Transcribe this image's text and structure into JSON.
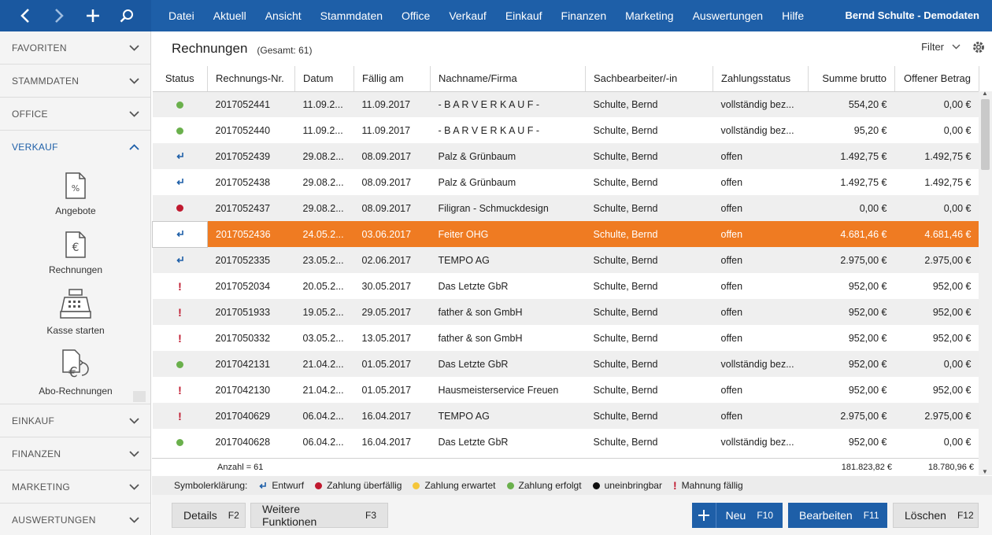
{
  "topbar": {
    "menu": [
      "Datei",
      "Aktuell",
      "Ansicht",
      "Stammdaten",
      "Office",
      "Verkauf",
      "Einkauf",
      "Finanzen",
      "Marketing",
      "Auswertungen",
      "Hilfe"
    ],
    "user": "Bernd Schulte - Demodaten",
    "icons": [
      "chevron-left-icon",
      "chevron-right-icon",
      "plus-icon",
      "search-icon"
    ]
  },
  "sidebar": {
    "sections_top": [
      "FAVORITEN",
      "STAMMDATEN",
      "OFFICE"
    ],
    "active_section": "VERKAUF",
    "tiles": [
      {
        "label": "Angebote",
        "icon": "offer-document-icon"
      },
      {
        "label": "Rechnungen",
        "icon": "invoice-euro-document-icon"
      },
      {
        "label": "Kasse starten",
        "icon": "cash-register-icon"
      },
      {
        "label": "Abo-Rechnungen",
        "icon": "subscription-invoice-icon"
      }
    ],
    "sections_bottom": [
      "EINKAUF",
      "FINANZEN",
      "MARKETING",
      "AUSWERTUNGEN"
    ]
  },
  "main": {
    "title": "Rechnungen",
    "total": "(Gesamt: 61)",
    "filter_label": "Filter"
  },
  "table": {
    "columns": [
      "Status",
      "Rechnungs-Nr.",
      "Datum",
      "Fällig am",
      "Nachname/Firma",
      "Sachbearbeiter/-in",
      "Zahlungsstatus",
      "Summe brutto",
      "Offener Betrag"
    ],
    "rows": [
      {
        "status": "green",
        "nr": "2017052441",
        "datum": "11.09.2...",
        "faellig": "11.09.2017",
        "firma": "- B A R V E R K A U F -",
        "bearbeiter": "Schulte, Bernd",
        "zahlung": "vollständig bez...",
        "brutto": "554,20 €",
        "offen": "0,00 €"
      },
      {
        "status": "green",
        "nr": "2017052440",
        "datum": "11.09.2...",
        "faellig": "11.09.2017",
        "firma": "- B A R V E R K A U F -",
        "bearbeiter": "Schulte, Bernd",
        "zahlung": "vollständig bez...",
        "brutto": "95,20 €",
        "offen": "0,00 €"
      },
      {
        "status": "entwurf",
        "nr": "2017052439",
        "datum": "29.08.2...",
        "faellig": "08.09.2017",
        "firma": "Palz & Grünbaum",
        "bearbeiter": "Schulte, Bernd",
        "zahlung": "offen",
        "brutto": "1.492,75 €",
        "offen": "1.492,75 €"
      },
      {
        "status": "entwurf",
        "nr": "2017052438",
        "datum": "29.08.2...",
        "faellig": "08.09.2017",
        "firma": "Palz & Grünbaum",
        "bearbeiter": "Schulte, Bernd",
        "zahlung": "offen",
        "brutto": "1.492,75 €",
        "offen": "1.492,75 €"
      },
      {
        "status": "red",
        "nr": "2017052437",
        "datum": "29.08.2...",
        "faellig": "08.09.2017",
        "firma": "Filigran - Schmuckdesign",
        "bearbeiter": "Schulte, Bernd",
        "zahlung": "offen",
        "brutto": "0,00 €",
        "offen": "0,00 €"
      },
      {
        "status": "entwurf",
        "nr": "2017052436",
        "datum": "24.05.2...",
        "faellig": "03.06.2017",
        "firma": "Feiter OHG",
        "bearbeiter": "Schulte, Bernd",
        "zahlung": "offen",
        "brutto": "4.681,46 €",
        "offen": "4.681,46 €",
        "selected": true
      },
      {
        "status": "entwurf",
        "nr": "2017052335",
        "datum": "23.05.2...",
        "faellig": "02.06.2017",
        "firma": "TEMPO AG",
        "bearbeiter": "Schulte, Bernd",
        "zahlung": "offen",
        "brutto": "2.975,00 €",
        "offen": "2.975,00 €"
      },
      {
        "status": "mahnung",
        "nr": "2017052034",
        "datum": "20.05.2...",
        "faellig": "30.05.2017",
        "firma": "Das Letzte GbR",
        "bearbeiter": "Schulte, Bernd",
        "zahlung": "offen",
        "brutto": "952,00 €",
        "offen": "952,00 €"
      },
      {
        "status": "mahnung",
        "nr": "2017051933",
        "datum": "19.05.2...",
        "faellig": "29.05.2017",
        "firma": "father & son GmbH",
        "bearbeiter": "Schulte, Bernd",
        "zahlung": "offen",
        "brutto": "952,00 €",
        "offen": "952,00 €"
      },
      {
        "status": "mahnung",
        "nr": "2017050332",
        "datum": "03.05.2...",
        "faellig": "13.05.2017",
        "firma": "father & son GmbH",
        "bearbeiter": "Schulte, Bernd",
        "zahlung": "offen",
        "brutto": "952,00 €",
        "offen": "952,00 €"
      },
      {
        "status": "green",
        "nr": "2017042131",
        "datum": "21.04.2...",
        "faellig": "01.05.2017",
        "firma": "Das Letzte GbR",
        "bearbeiter": "Schulte, Bernd",
        "zahlung": "vollständig bez...",
        "brutto": "952,00 €",
        "offen": "0,00 €"
      },
      {
        "status": "mahnung",
        "nr": "2017042130",
        "datum": "21.04.2...",
        "faellig": "01.05.2017",
        "firma": "Hausmeisterservice Freuen",
        "bearbeiter": "Schulte, Bernd",
        "zahlung": "offen",
        "brutto": "952,00 €",
        "offen": "952,00 €"
      },
      {
        "status": "mahnung",
        "nr": "2017040629",
        "datum": "06.04.2...",
        "faellig": "16.04.2017",
        "firma": "TEMPO AG",
        "bearbeiter": "Schulte, Bernd",
        "zahlung": "offen",
        "brutto": "2.975,00 €",
        "offen": "2.975,00 €"
      },
      {
        "status": "green",
        "nr": "2017040628",
        "datum": "06.04.2...",
        "faellig": "16.04.2017",
        "firma": "Das Letzte GbR",
        "bearbeiter": "Schulte, Bernd",
        "zahlung": "vollständig bez...",
        "brutto": "952,00 €",
        "offen": "0,00 €"
      }
    ],
    "summary": {
      "count": "Anzahl = 61",
      "brutto": "181.823,82 €",
      "offen": "18.780,96 €"
    }
  },
  "legend": {
    "title": "Symbolerklärung:",
    "items": [
      {
        "type": "entwurf",
        "label": "Entwurf"
      },
      {
        "type": "red",
        "label": "Zahlung überfällig"
      },
      {
        "type": "yellow",
        "label": "Zahlung erwartet"
      },
      {
        "type": "green",
        "label": "Zahlung erfolgt"
      },
      {
        "type": "black",
        "label": "uneinbringbar"
      },
      {
        "type": "mahnung",
        "label": "Mahnung fällig"
      }
    ]
  },
  "footer": {
    "details": {
      "label": "Details",
      "key": "F2"
    },
    "weitere": {
      "label": "Weitere Funktionen",
      "key": "F3"
    },
    "neu": {
      "label": "Neu",
      "key": "F10"
    },
    "bearbeiten": {
      "label": "Bearbeiten",
      "key": "F11"
    },
    "loeschen": {
      "label": "Löschen",
      "key": "F12"
    }
  },
  "colors": {
    "brand": "#1e5fa8",
    "selection": "#ef7b22",
    "paid": "#6ab04c",
    "overdue": "#c0192f",
    "expected": "#f5c63a"
  }
}
